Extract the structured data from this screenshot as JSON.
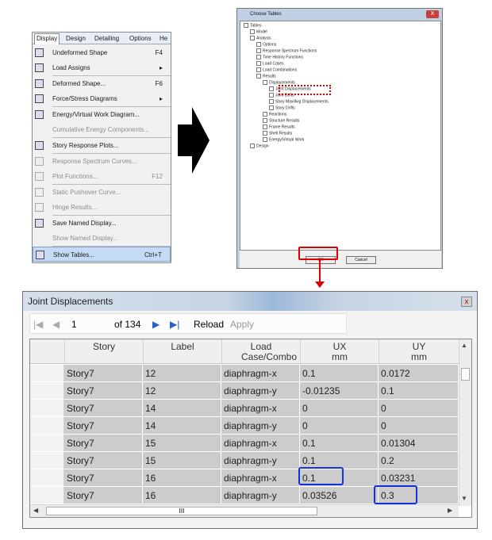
{
  "menu": {
    "tabs": [
      "Display",
      "Design",
      "Detailing",
      "Options",
      "He"
    ],
    "items": [
      {
        "label": "Undeformed Shape",
        "shortcut": "F4",
        "disabled": false,
        "submenu": false
      },
      {
        "label": "Load Assigns",
        "shortcut": "",
        "disabled": false,
        "submenu": true
      },
      {
        "label": "Deformed Shape...",
        "shortcut": "F6",
        "disabled": false,
        "submenu": false
      },
      {
        "label": "Force/Stress Diagrams",
        "shortcut": "",
        "disabled": false,
        "submenu": true
      },
      {
        "label": "Energy/Virtual Work Diagram...",
        "shortcut": "",
        "disabled": false,
        "submenu": false
      },
      {
        "label": "Cumulative Energy Components...",
        "shortcut": "",
        "disabled": true,
        "submenu": false
      },
      {
        "label": "Story Response Plots...",
        "shortcut": "",
        "disabled": false,
        "submenu": false
      },
      {
        "label": "Response Spectrum Curves...",
        "shortcut": "",
        "disabled": true,
        "submenu": false
      },
      {
        "label": "Plot Functions...",
        "shortcut": "F12",
        "disabled": true,
        "submenu": false
      },
      {
        "label": "Static Pushover Curve...",
        "shortcut": "",
        "disabled": true,
        "submenu": false
      },
      {
        "label": "Hinge Results...",
        "shortcut": "",
        "disabled": true,
        "submenu": false
      },
      {
        "label": "Save Named Display...",
        "shortcut": "",
        "disabled": false,
        "submenu": false
      },
      {
        "label": "Show Named Display...",
        "shortcut": "",
        "disabled": true,
        "submenu": false
      },
      {
        "label": "Show Tables...",
        "shortcut": "Ctrl+T",
        "disabled": false,
        "submenu": false
      }
    ]
  },
  "dialog": {
    "title": "Choose Tables",
    "close": "X",
    "tree": [
      "Tables",
      "Model",
      "Analysis",
      "Options",
      "Response Spectrum Functions",
      "Time History Functions",
      "Load Cases",
      "Load Combinations",
      "Results",
      "Displacements",
      "Joint Displacements",
      "Joint Drifts",
      "Story Max/Avg Displacements",
      "Story Drifts",
      "Reactions",
      "Structure Results",
      "Frame Results",
      "Shell Results",
      "Energy/Virtual Work",
      "Design"
    ],
    "ok": "OK",
    "cancel": "Cancel"
  },
  "table_window": {
    "title": "Joint Displacements",
    "close": "x",
    "nav": {
      "page": "1",
      "of": "of 134",
      "reload": "Reload",
      "apply": "Apply"
    },
    "columns": [
      {
        "name": "Story",
        "unit": ""
      },
      {
        "name": "Label",
        "unit": ""
      },
      {
        "name": "Load Case/Combo",
        "unit": ""
      },
      {
        "name": "UX",
        "unit": "mm"
      },
      {
        "name": "UY",
        "unit": "mm"
      }
    ],
    "rows": [
      [
        "Story7",
        "12",
        "diaphragm-x",
        "0.1",
        "0.0172"
      ],
      [
        "Story7",
        "12",
        "diaphragm-y",
        "-0.01235",
        "0.1"
      ],
      [
        "Story7",
        "14",
        "diaphragm-x",
        "0",
        "0"
      ],
      [
        "Story7",
        "14",
        "diaphragm-y",
        "0",
        "0"
      ],
      [
        "Story7",
        "15",
        "diaphragm-x",
        "0.1",
        "0.01304"
      ],
      [
        "Story7",
        "15",
        "diaphragm-y",
        "0.1",
        "0.2"
      ],
      [
        "Story7",
        "16",
        "diaphragm-x",
        "0.1",
        "0.03231"
      ],
      [
        "Story7",
        "16",
        "diaphragm-y",
        "0.03526",
        "0.3"
      ]
    ],
    "hscroll_thumb": "III"
  }
}
